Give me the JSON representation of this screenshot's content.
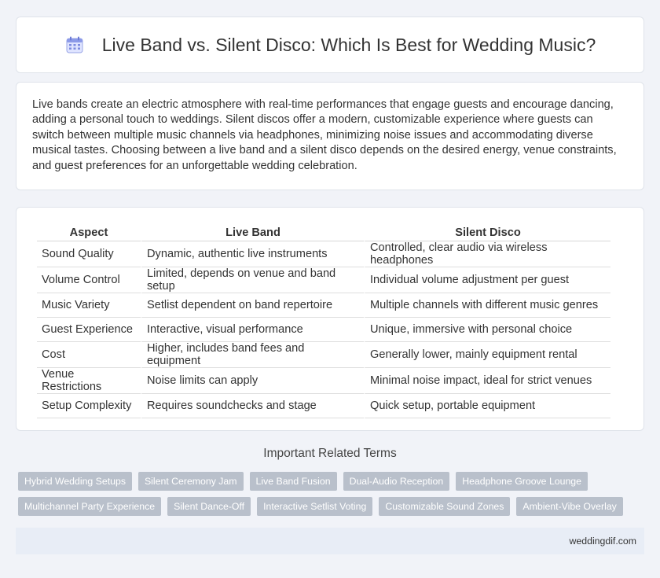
{
  "header": {
    "title": "Live Band vs. Silent Disco: Which Is Best for Wedding Music?",
    "icon": "calendar-icon"
  },
  "intro": {
    "text": "Live bands create an electric atmosphere with real-time performances that engage guests and encourage dancing, adding a personal touch to weddings. Silent discos offer a modern, customizable experience where guests can switch between multiple music channels via headphones, minimizing noise issues and accommodating diverse musical tastes. Choosing between a live band and a silent disco depends on the desired energy, venue constraints, and guest preferences for an unforgettable wedding celebration."
  },
  "table": {
    "headers": [
      "Aspect",
      "Live Band",
      "Silent Disco"
    ],
    "rows": [
      [
        "Sound Quality",
        "Dynamic, authentic live instruments",
        "Controlled, clear audio via wireless headphones"
      ],
      [
        "Volume Control",
        "Limited, depends on venue and band setup",
        "Individual volume adjustment per guest"
      ],
      [
        "Music Variety",
        "Setlist dependent on band repertoire",
        "Multiple channels with different music genres"
      ],
      [
        "Guest Experience",
        "Interactive, visual performance",
        "Unique, immersive with personal choice"
      ],
      [
        "Cost",
        "Higher, includes band fees and equipment",
        "Generally lower, mainly equipment rental"
      ],
      [
        "Venue Restrictions",
        "Noise limits can apply",
        "Minimal noise impact, ideal for strict venues"
      ],
      [
        "Setup Complexity",
        "Requires soundchecks and stage",
        "Quick setup, portable equipment"
      ]
    ]
  },
  "related": {
    "title": "Important Related Terms",
    "rows": [
      [
        "Hybrid Wedding Setups",
        "Silent Ceremony Jam",
        "Live Band Fusion",
        "Dual-Audio Reception",
        "Headphone Groove Lounge"
      ],
      [
        "Multichannel Party Experience",
        "Silent Dance-Off",
        "Interactive Setlist Voting",
        "Customizable Sound Zones",
        "Ambient-Vibe Overlay"
      ]
    ]
  },
  "footer": {
    "site": "weddingdif.com"
  },
  "colors": {
    "background": "#f1f3f8",
    "tag": "#b9c0cb",
    "footer": "#e8edf6"
  }
}
